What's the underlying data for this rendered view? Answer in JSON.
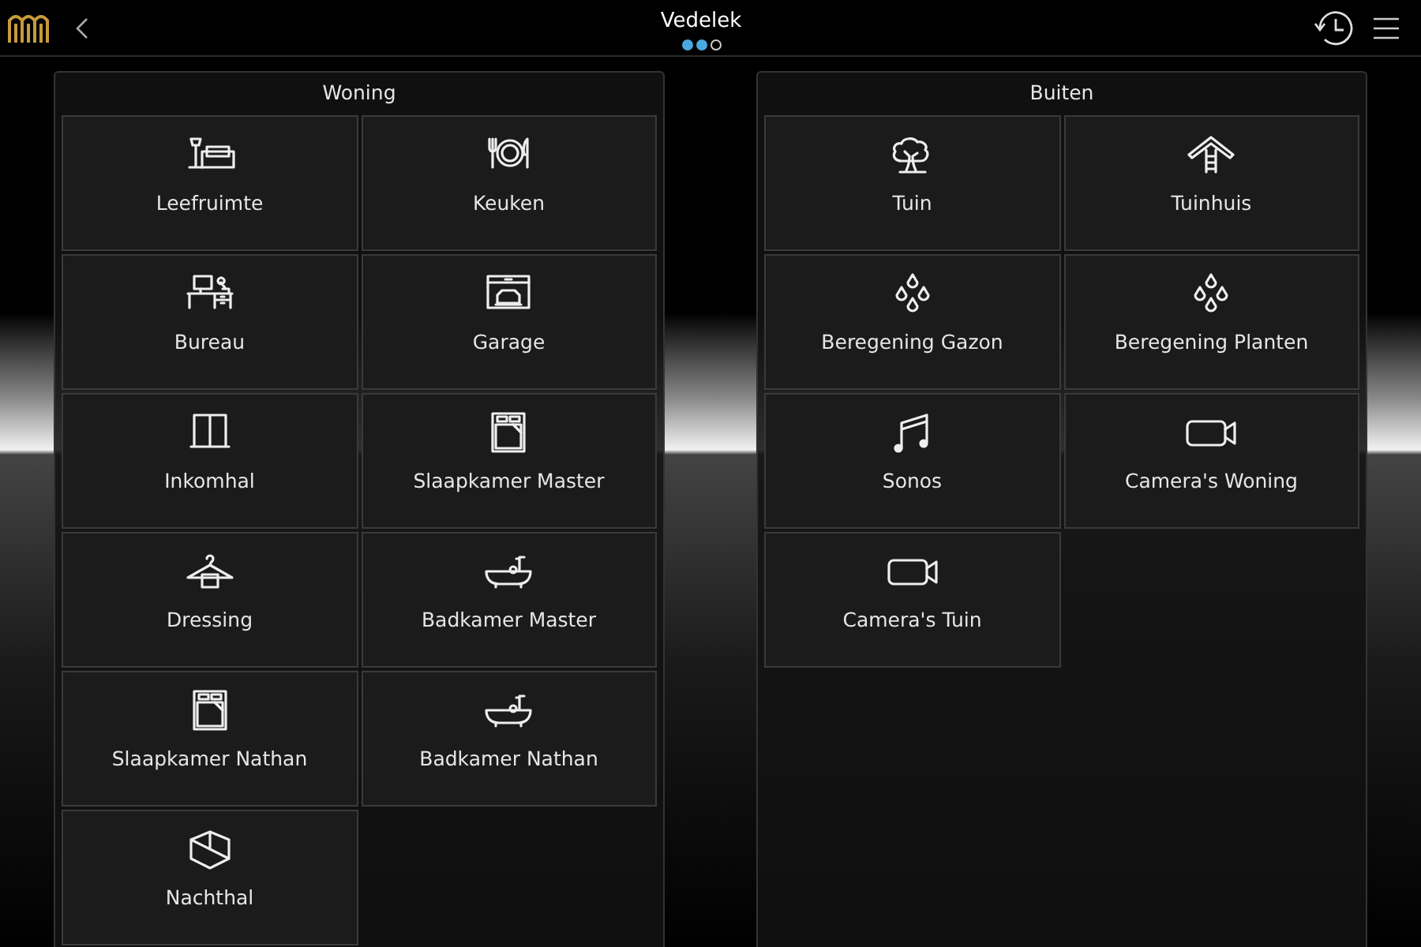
{
  "header": {
    "title": "Vedelek",
    "pages": [
      {
        "selected": true
      },
      {
        "selected": true
      },
      {
        "selected": false
      }
    ]
  },
  "panels": [
    {
      "title": "Woning",
      "tiles": [
        {
          "label": "Leefruimte",
          "kind": "living"
        },
        {
          "label": "Keuken",
          "kind": "dining"
        },
        {
          "label": "Bureau",
          "kind": "desk"
        },
        {
          "label": "Garage",
          "kind": "garage"
        },
        {
          "label": "Inkomhal",
          "kind": "door"
        },
        {
          "label": "Slaapkamer Master",
          "kind": "bed"
        },
        {
          "label": "Dressing",
          "kind": "hanger"
        },
        {
          "label": "Badkamer Master",
          "kind": "bath"
        },
        {
          "label": "Slaapkamer Nathan",
          "kind": "bed"
        },
        {
          "label": "Badkamer Nathan",
          "kind": "bath"
        },
        {
          "label": "Nachthal",
          "kind": "cube"
        }
      ]
    },
    {
      "title": "Buiten",
      "tiles": [
        {
          "label": "Tuin",
          "kind": "tree"
        },
        {
          "label": "Tuinhuis",
          "kind": "shed"
        },
        {
          "label": "Beregening Gazon",
          "kind": "drops"
        },
        {
          "label": "Beregening Planten",
          "kind": "drops"
        },
        {
          "label": "Sonos",
          "kind": "music"
        },
        {
          "label": "Camera's Woning",
          "kind": "camera"
        },
        {
          "label": "Camera's Tuin",
          "kind": "camera"
        }
      ]
    }
  ]
}
